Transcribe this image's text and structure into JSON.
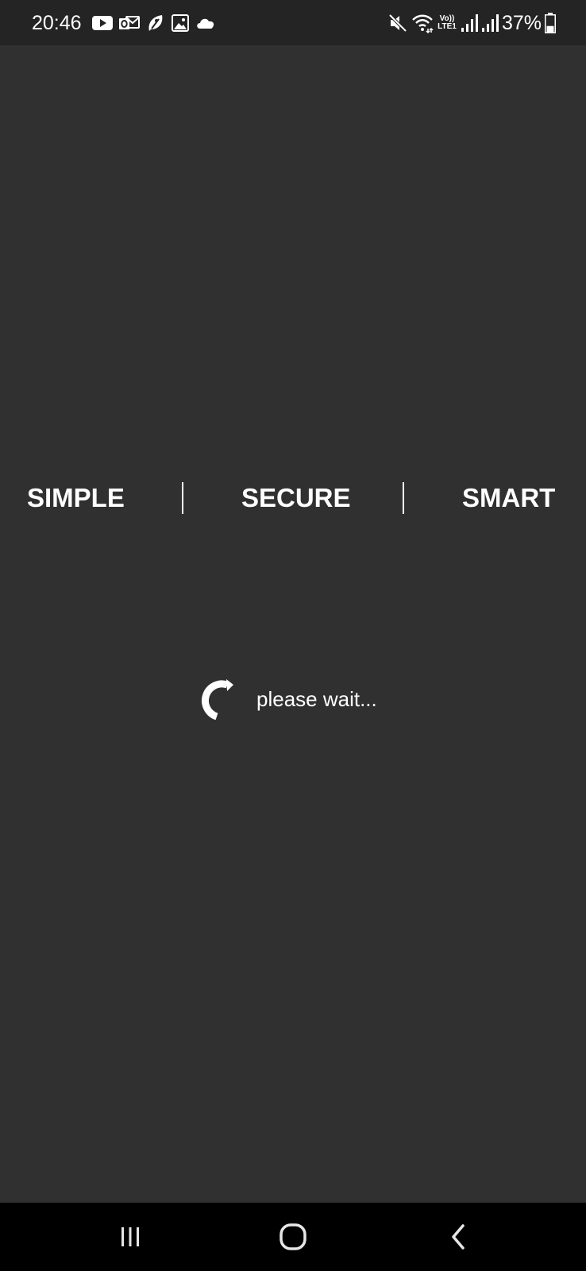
{
  "status_bar": {
    "time": "20:46",
    "battery_percent": "37%",
    "network_label_top": "Vo))",
    "network_label_bottom": "LTE1",
    "left_icons": [
      "youtube-icon",
      "outlook-icon",
      "app-leaf-icon",
      "gallery-icon",
      "cloud-icon"
    ],
    "right_icons": [
      "mute-icon",
      "wifi-icon",
      "signal-icon",
      "signal-icon",
      "battery-icon"
    ],
    "battery_level": 0.37
  },
  "tagline": {
    "word_1": "SIMPLE",
    "word_2": "SECURE",
    "word_3": "SMART"
  },
  "loading": {
    "message": "please wait..."
  },
  "nav_bar": {
    "buttons": [
      "recent-apps-icon",
      "home-icon",
      "back-icon"
    ]
  },
  "colors": {
    "background": "#303030",
    "status_bar": "#242424",
    "nav_bar": "#000000",
    "text": "#ffffff"
  }
}
